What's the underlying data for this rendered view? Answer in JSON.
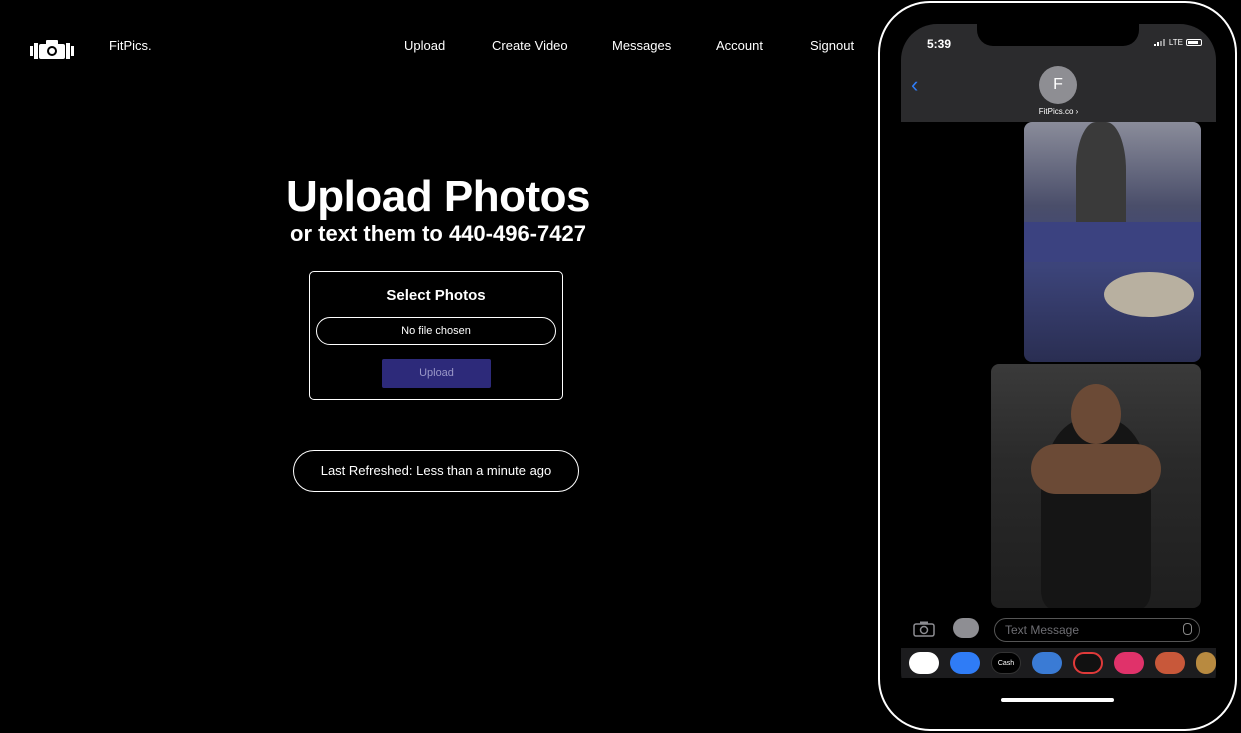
{
  "site": {
    "brand": "FitPics.",
    "nav": [
      "Upload",
      "Create Video",
      "Messages",
      "Account",
      "Signout"
    ],
    "hero_title": "Upload Photos",
    "hero_sub": "or text them to 440-496-7427",
    "card": {
      "title": "Select Photos",
      "file_status": "No file chosen",
      "upload_label": "Upload"
    },
    "refresh": "Last Refreshed: Less than a minute ago"
  },
  "phone": {
    "time": "5:39",
    "network": "LTE",
    "avatar_initial": "F",
    "contact": "FitPics.co ›",
    "input_placeholder": "Text Message",
    "apps": [
      "photos",
      "app-store",
      "Cash",
      "audio",
      "activity",
      "search",
      "memoji",
      "memoji-2"
    ],
    "app_cash_label": "Cash"
  },
  "colors": {
    "accent_button": "#2d2a7a",
    "ios_blue": "#2f7cf6"
  }
}
